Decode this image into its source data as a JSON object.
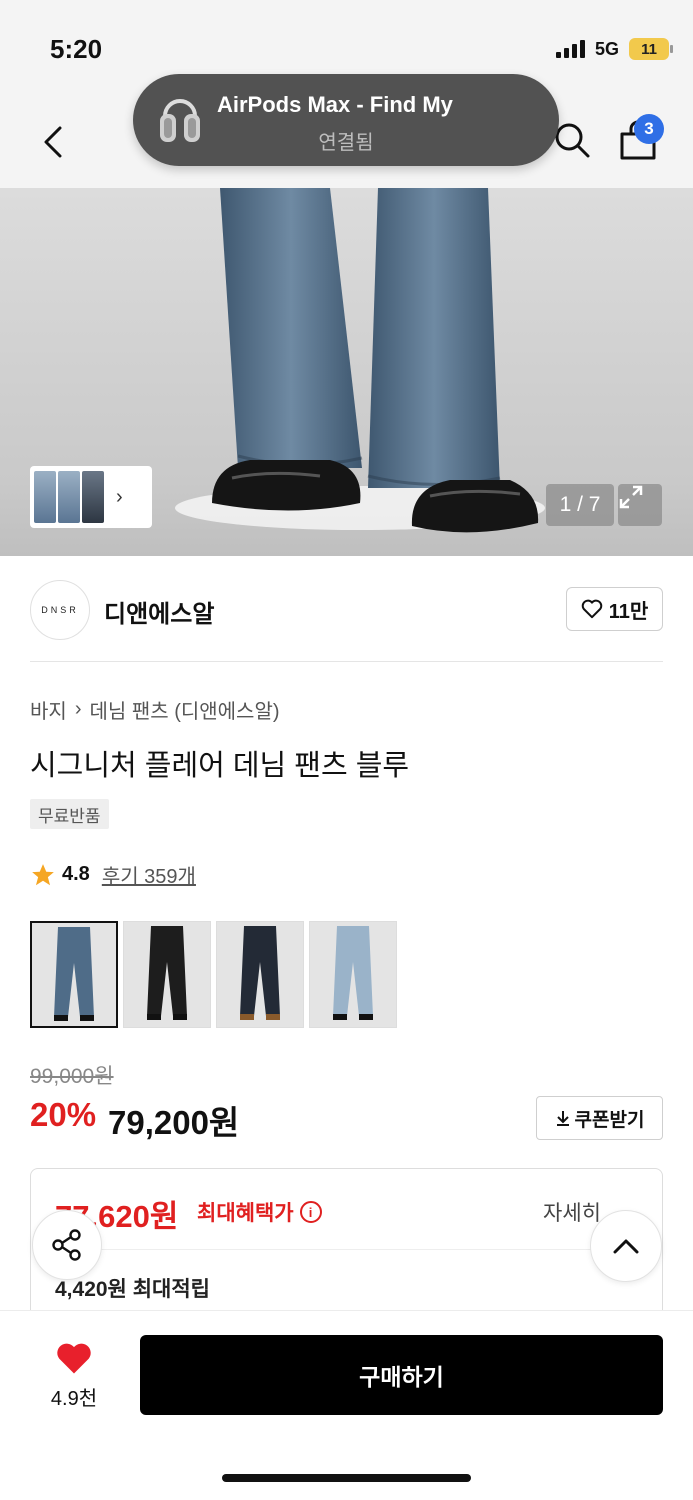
{
  "status": {
    "time": "5:20",
    "network": "5G",
    "battery": "11"
  },
  "notification": {
    "title": "AirPods Max - Find My",
    "subtitle": "연결됨"
  },
  "header": {
    "cart_count": "3"
  },
  "gallery": {
    "page_indicator": "1 / 7"
  },
  "brand": {
    "logo_text": "DNSR",
    "name": "디앤에스알",
    "likes": "11만"
  },
  "breadcrumb": {
    "category": "바지",
    "subcategory": "데님 팬츠 (디앤에스알)"
  },
  "product": {
    "title": "시그니처 플레어 데님 팬츠 블루",
    "tag": "무료반품",
    "rating": "4.8",
    "reviews": "후기 359개",
    "original_price": "99,000원",
    "discount": "20%",
    "sale_price": "79,200원",
    "coupon_label": "쿠폰받기"
  },
  "benefits": {
    "max_price": "77,620원",
    "max_label": "최대혜택가",
    "detail_label": "자세히",
    "points": "4,420원 최대적립"
  },
  "bottom": {
    "wish_count": "4.9천",
    "buy_label": "구매하기"
  },
  "colors": {
    "denim_light": "#9fb6cc",
    "denim_mid": "#5c7794",
    "denim_dark": "#2b3440",
    "accent_red": "#e02020",
    "badge_blue": "#2f6fe6"
  }
}
